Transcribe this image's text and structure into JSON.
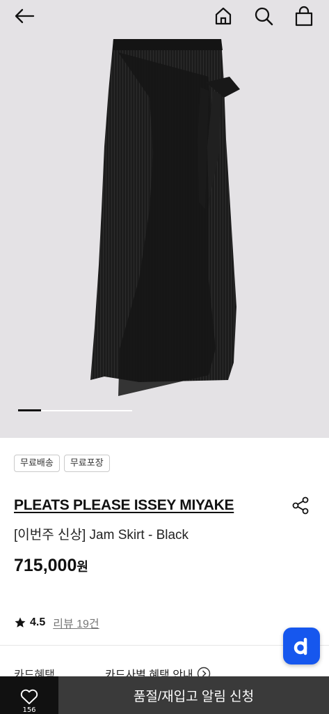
{
  "header": {
    "back_icon": "arrow-left-icon",
    "home_icon": "home-icon",
    "search_icon": "search-icon",
    "bag_icon": "shopping-bag-icon"
  },
  "gallery": {
    "background": "#e4e2e5",
    "image": "black-pleated-wrap-skirt"
  },
  "badges": [
    "무료배송",
    "무료포장"
  ],
  "product": {
    "brand": "PLEATS PLEASE ISSEY MIYAKE",
    "name": "[이번주 신상] Jam Skirt - Black",
    "price": "715,000",
    "price_unit": "원"
  },
  "rating": {
    "score": "4.5",
    "review_label": "리뷰 19건"
  },
  "card_benefit": {
    "label": "카드혜택",
    "info": "카드사별 혜택 안내"
  },
  "fab": {
    "label": "d",
    "color": "#1657ee"
  },
  "bottom_bar": {
    "wish_count": "156",
    "notify_label": "품절/재입고 알림 신청"
  }
}
